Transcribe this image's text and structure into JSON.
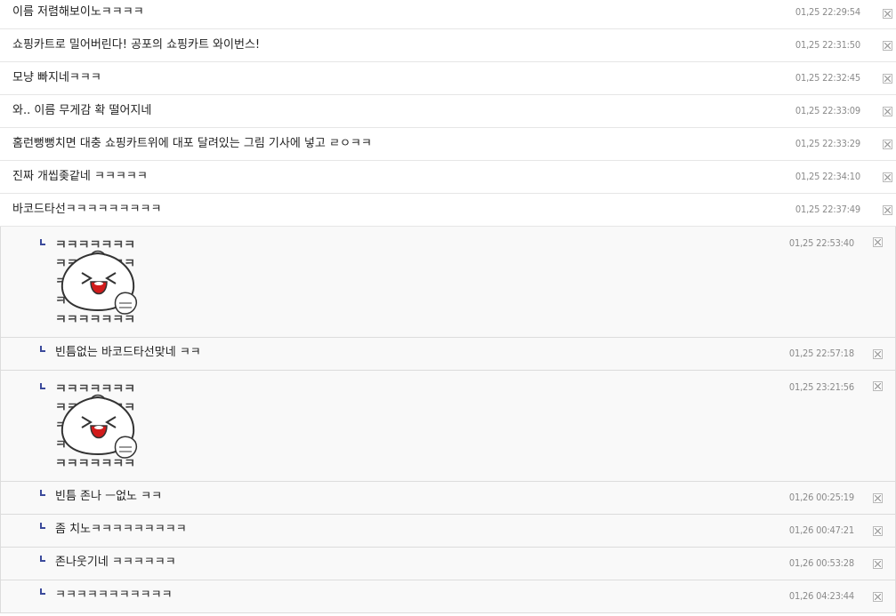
{
  "comments": [
    {
      "text": "이름 저렴해보이노ㅋㅋㅋㅋ",
      "date": "01,25 22:29:54"
    },
    {
      "text": "쇼핑카트로 밀어버린다! 공포의 쇼핑카트 와이번스!",
      "date": "01,25 22:31:50"
    },
    {
      "text": "모냥 빠지네ㅋㅋㅋ",
      "date": "01,25 22:32:45"
    },
    {
      "text": "와.. 이름 무게감 확 떨어지네",
      "date": "01,25 22:33:09"
    },
    {
      "text": "홈런뻥뻥치면 대충 쇼핑카트위에 대포 달려있는 그림 기사에 넣고 ㄹㅇㅋㅋ",
      "date": "01,25 22:33:29"
    },
    {
      "text": "진짜 개씹좆같네 ㅋㅋㅋㅋㅋ",
      "date": "01,25 22:34:10"
    },
    {
      "text": "바코드타선ㅋㅋㅋㅋㅋㅋㅋㅋㅋ",
      "date": "01,25 22:37:49"
    }
  ],
  "replies": [
    {
      "type": "sticker",
      "sticker_text": "ㅋㅋㅋㅋㅋㅋㅋ",
      "date": "01,25 22:53:40"
    },
    {
      "type": "text",
      "text": "빈틈없는 바코드타선맞네 ㅋㅋ",
      "date": "01,25 22:57:18"
    },
    {
      "type": "sticker",
      "sticker_text": "ㅋㅋㅋㅋㅋㅋㅋ",
      "date": "01,25 23:21:56"
    },
    {
      "type": "text",
      "text": "빈틈 존나 ㅡ없노 ㅋㅋ",
      "date": "01,26 00:25:19"
    },
    {
      "type": "text",
      "text": "좀 치노ㅋㅋㅋㅋㅋㅋㅋㅋㅋ",
      "date": "01,26 00:47:21"
    },
    {
      "type": "text",
      "text": "존나웃기네 ㅋㅋㅋㅋㅋㅋ",
      "date": "01,26 00:53:28"
    },
    {
      "type": "text",
      "text": "ㅋㅋㅋㅋㅋㅋㅋㅋㅋㅋㅋ",
      "date": "01,26 04:23:44"
    }
  ],
  "icons": {
    "delete": "close-box-icon",
    "reply": "reply-arrow-icon",
    "sticker": "laughing-dumpling-sticker"
  },
  "colors": {
    "reply_mark": "#3b4a9b",
    "date": "#8a8a8a",
    "sticker_mouth": "#d11b1b"
  }
}
